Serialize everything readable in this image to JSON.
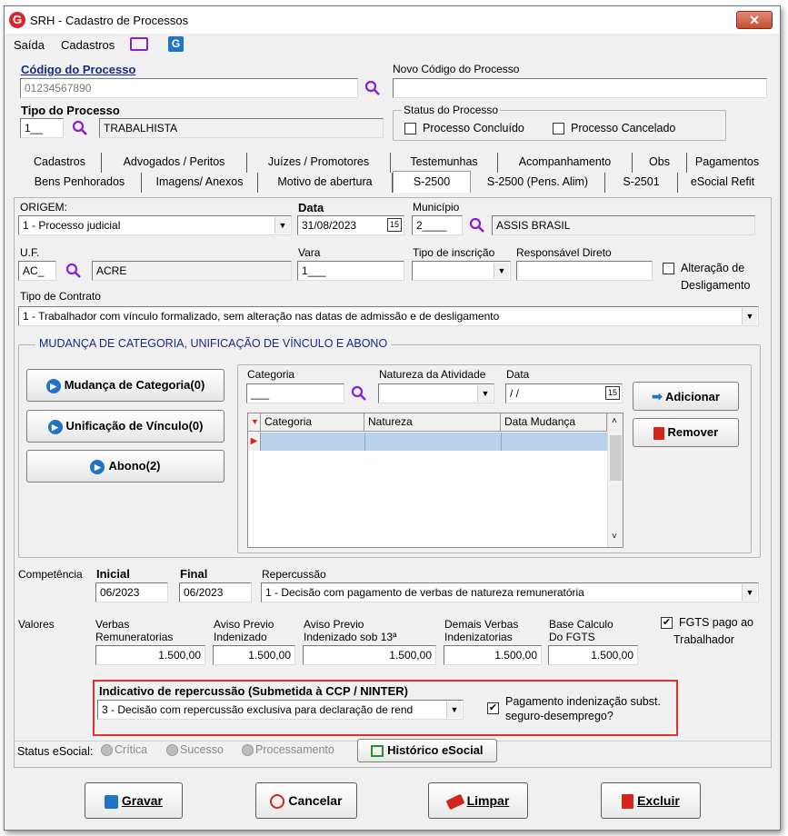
{
  "window": {
    "title": "SRH - Cadastro de Processos",
    "close_glyph": "✕"
  },
  "menu": {
    "saida": "Saída",
    "cadastros": "Cadastros"
  },
  "header": {
    "codigo_label": "Código do Processo",
    "codigo_value": "01234567890",
    "novo_codigo_label": "Novo Código do Processo",
    "novo_codigo_value": "",
    "tipo_label": "Tipo do Processo",
    "tipo_code": "1__",
    "tipo_desc": "TRABALHISTA",
    "status_label": "Status do Processo",
    "status_concluido": "Processo Concluído",
    "status_cancelado": "Processo Cancelado"
  },
  "tabs_row1": [
    "Cadastros",
    "Advogados / Peritos",
    "Juízes / Promotores",
    "Testemunhas",
    "Acompanhamento",
    "Obs",
    "Pagamentos"
  ],
  "tabs_row2": [
    "Bens Penhorados",
    "Imagens/ Anexos",
    "Motivo de abertura",
    "S-2500",
    "S-2500 (Pens. Alim)",
    "S-2501",
    "eSocial Refit"
  ],
  "form": {
    "origem_label": "ORIGEM:",
    "origem_value": "1 - Processo judicial",
    "data_label": "Data",
    "data_value": "31/08/2023",
    "municipio_label": "Município",
    "municipio_code": "2____",
    "municipio_desc": "ASSIS BRASIL",
    "uf_label": "U.F.",
    "uf_code": "AC_",
    "uf_desc": "ACRE",
    "vara_label": "Vara",
    "vara_value": "1___",
    "tipo_inscricao_label": "Tipo de inscrição",
    "tipo_inscricao_value": "",
    "responsavel_label": "Responsável Direto",
    "responsavel_value": "",
    "alteracao_label_1": "Alteração de",
    "alteracao_label_2": "Desligamento",
    "tipo_contrato_label": "Tipo de Contrato",
    "tipo_contrato_value": "1 - Trabalhador com vínculo formalizado, sem alteração nas datas de admissão e de desligamento"
  },
  "mudanca": {
    "group_title": "MUDANÇA DE CATEGORIA, UNIFICAÇÃO DE VÍNCULO E ABONO",
    "btn_mudanca": "Mudança de Categoria(0)",
    "btn_unificacao": "Unificação de Vínculo(0)",
    "btn_abono": "Abono(2)",
    "categoria_label": "Categoria",
    "categoria_value": "___",
    "natureza_label": "Natureza da Atividade",
    "natureza_value": "",
    "data_label": "Data",
    "data_value": " / /",
    "btn_adicionar": "Adicionar",
    "btn_remover": "Remover",
    "grid_columns": [
      "Categoria",
      "Natureza",
      "Data Mudança"
    ]
  },
  "competencia": {
    "label": "Competência",
    "inicial_label": "Inicial",
    "inicial_value": "06/2023",
    "final_label": "Final",
    "final_value": "06/2023",
    "repercussao_label": "Repercussão",
    "repercussao_value": "1 - Decisão com pagamento de verbas de natureza remuneratória"
  },
  "valores": {
    "label": "Valores",
    "verbas_label_1": "Verbas",
    "verbas_label_2": "Remuneratorias",
    "verbas_value": "1.500,00",
    "aviso_label_1": "Aviso Previo",
    "aviso_label_2": "Indenizado",
    "aviso_value": "1.500,00",
    "aviso13_label_1": "Aviso Previo",
    "aviso13_label_2": "Indenizado sob 13ª",
    "aviso13_value": "1.500,00",
    "demais_label_1": "Demais Verbas",
    "demais_label_2": "Indenizatorias",
    "demais_value": "1.500,00",
    "base_label_1": "Base Calculo",
    "base_label_2": "Do FGTS",
    "base_value": "1.500,00",
    "fgts_label_1": "FGTS pago ao",
    "fgts_label_2": "Trabalhador"
  },
  "indicativo": {
    "label": "Indicativo de repercussão (Submetida à CCP / NINTER)",
    "value": "3 - Decisão com repercussão exclusiva para declaração de rend",
    "pagamento_label_1": "Pagamento indenização subst.",
    "pagamento_label_2": "seguro-desemprego?"
  },
  "status_esocial": {
    "label": "Status eSocial:",
    "critica": "Crítica",
    "sucesso": "Sucesso",
    "processamento": "Processamento",
    "historico": "Histórico eSocial"
  },
  "buttons": {
    "gravar": "Gravar",
    "cancelar": "Cancelar",
    "limpar": "Limpar",
    "excluir": "Excluir"
  },
  "colors": {
    "accent_purple": "#8a1fd0",
    "title_blue": "#1a2a88",
    "highlight_red": "#e0302b",
    "grid_select": "#b9d1ea"
  }
}
